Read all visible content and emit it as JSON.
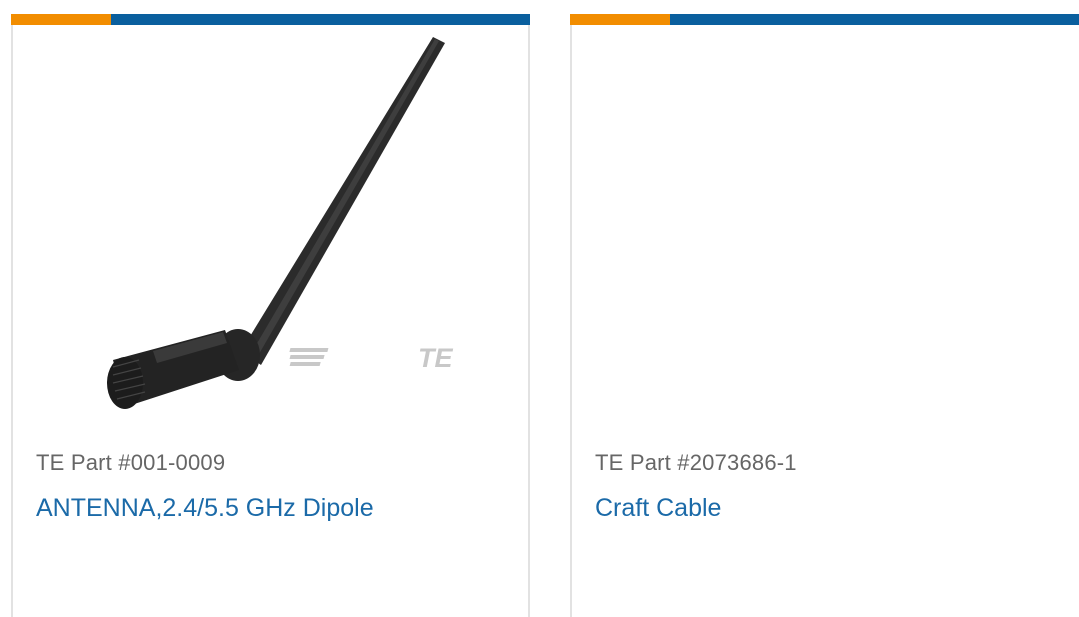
{
  "products": [
    {
      "part_number": "TE Part #001-0009",
      "name": "ANTENNA,2.4/5.5 GHz Dipole",
      "image": "antenna-photo",
      "logo_text": "TE"
    },
    {
      "part_number": "TE Part #2073686-1",
      "name": "Craft Cable",
      "image": "blank"
    }
  ],
  "colors": {
    "accent_orange": "#f28d00",
    "accent_blue": "#0a5f9e",
    "link_blue": "#1b6aa8",
    "part_text": "#666666"
  }
}
